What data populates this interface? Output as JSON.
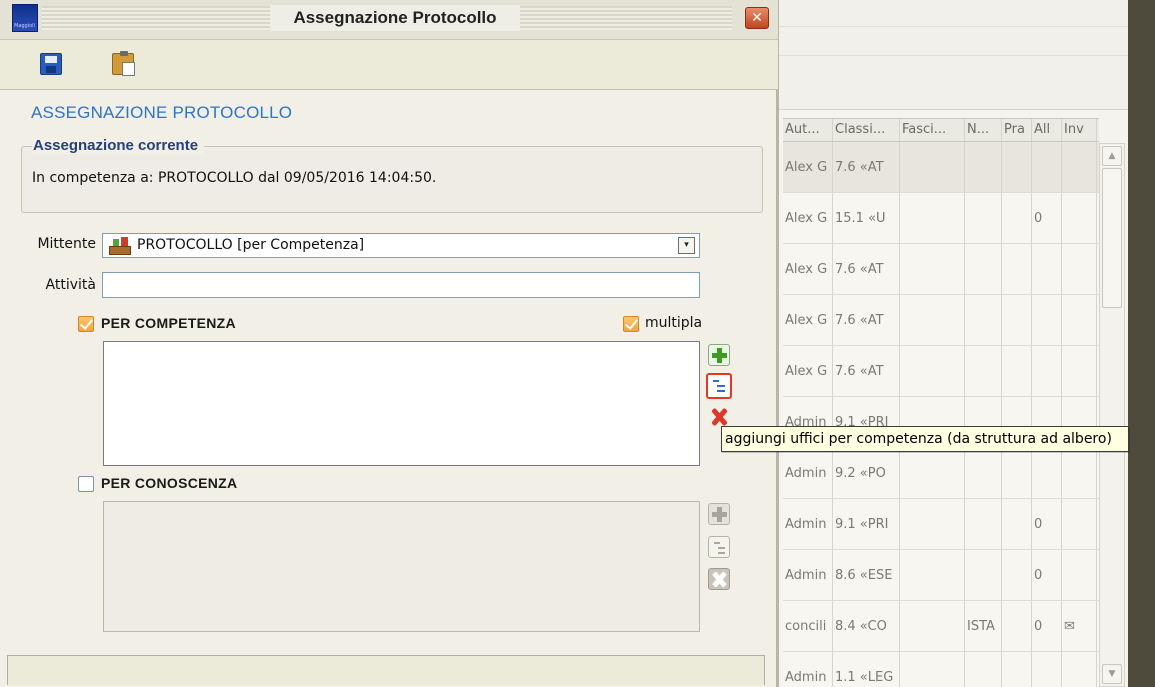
{
  "window": {
    "title": "Assegnazione Protocollo",
    "close_label": "✕",
    "logo_text": "Maggioli"
  },
  "toolbar": {
    "save_icon": "save-icon",
    "paste_icon": "paste-icon"
  },
  "form": {
    "heading": "ASSEGNAZIONE PROTOCOLLO",
    "current": {
      "legend": "Assegnazione corrente",
      "text": "In competenza a: PROTOCOLLO  dal  09/05/2016 14:04:50."
    },
    "mittente": {
      "label": "Mittente",
      "value": "PROTOCOLLO [per Competenza]",
      "dropdown_arrow": "▾"
    },
    "attivita": {
      "label": "Attività",
      "value": ""
    },
    "per_competenza": {
      "label": "PER COMPETENZA",
      "checked": true,
      "multipla_label": "multipla",
      "multipla_checked": true
    },
    "per_conoscenza": {
      "label": "PER CONOSCENZA",
      "checked": false
    }
  },
  "tooltip": {
    "text": "aggiungi uffici per competenza (da struttura ad albero)"
  },
  "background_table": {
    "headers": [
      "Aut...",
      "Classi...",
      "Fasci...",
      "N...",
      "Pra",
      "All",
      "Inv"
    ],
    "rows": [
      {
        "aut": "Alex G",
        "classi": "7.6 «AT",
        "n": "",
        "all": "",
        "inv": "",
        "sel": true
      },
      {
        "aut": "Alex G",
        "classi": "15.1 «U",
        "n": "",
        "all": "0",
        "inv": ""
      },
      {
        "aut": "Alex G",
        "classi": "7.6 «AT",
        "n": "",
        "all": "",
        "inv": ""
      },
      {
        "aut": "Alex G",
        "classi": "7.6 «AT",
        "n": "",
        "all": "",
        "inv": ""
      },
      {
        "aut": "Alex G",
        "classi": "7.6 «AT",
        "n": "",
        "all": "",
        "inv": ""
      },
      {
        "aut": "Admin",
        "classi": "9.1 «PRI",
        "n": "",
        "all": "",
        "inv": ""
      },
      {
        "aut": "Admin",
        "classi": "9.2 «PO",
        "n": "",
        "all": "",
        "inv": ""
      },
      {
        "aut": "Admin",
        "classi": "9.1 «PRI",
        "n": "",
        "all": "0",
        "inv": ""
      },
      {
        "aut": "Admin",
        "classi": "8.6 «ESE",
        "n": "",
        "all": "0",
        "inv": ""
      },
      {
        "aut": "concili",
        "classi": "8.4 «CO",
        "n": "ISTA",
        "all": "0",
        "inv": "✉"
      },
      {
        "aut": "Admin",
        "classi": "1.1 «LEG",
        "n": "",
        "all": "",
        "inv": ""
      }
    ]
  },
  "colors": {
    "heading": "#2f73c9",
    "legend": "#26407b",
    "tooltip_bg": "#ffffe1",
    "highlight": "#e2372a"
  }
}
